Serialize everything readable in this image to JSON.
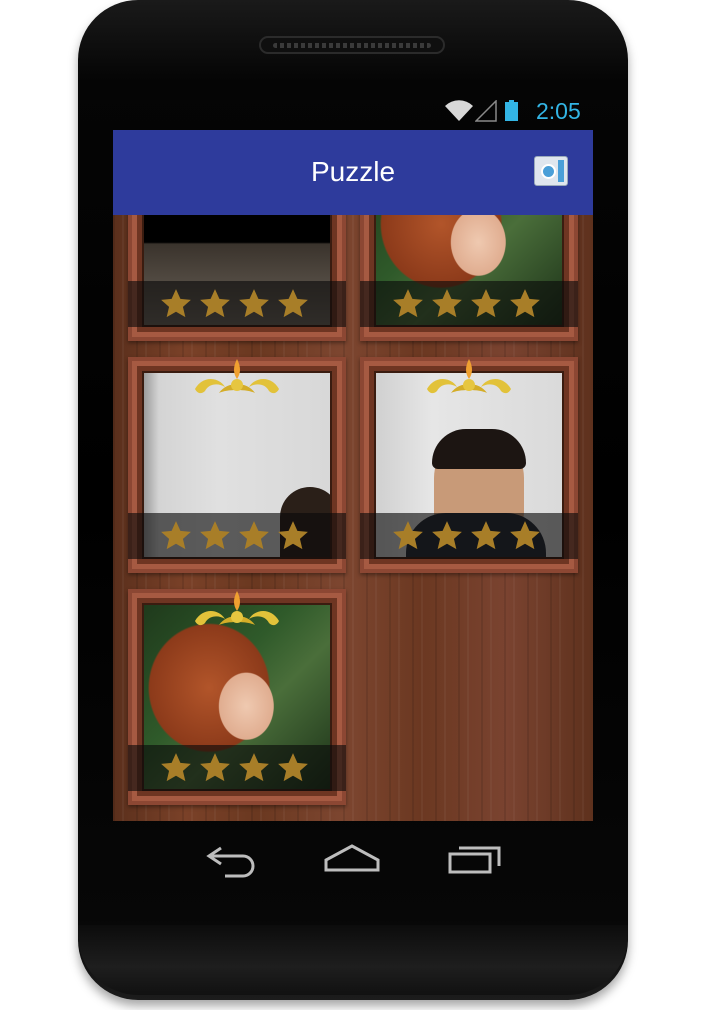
{
  "status_bar": {
    "time": "2:05",
    "wifi_icon": "wifi-icon",
    "signal_icon": "signal-icon",
    "battery_icon": "battery-icon"
  },
  "action_bar": {
    "title": "Puzzle",
    "camera_icon": "camera-icon"
  },
  "puzzles": [
    {
      "image": "desk-photo",
      "stars": 4,
      "ornament": false
    },
    {
      "image": "monkey-photo",
      "stars": 4,
      "ornament": false
    },
    {
      "image": "wall-photo",
      "stars": 4,
      "ornament": true
    },
    {
      "image": "person-photo",
      "stars": 4,
      "ornament": true
    },
    {
      "image": "monkey-photo",
      "stars": 4,
      "ornament": true
    }
  ],
  "nav_bar": {
    "back_icon": "back-icon",
    "home_icon": "home-icon",
    "recents_icon": "recents-icon"
  },
  "colors": {
    "action_bar": "#2e3b9c",
    "status_accent": "#33b5e5",
    "star": "#b8892a",
    "wood": "#6e3a22"
  }
}
